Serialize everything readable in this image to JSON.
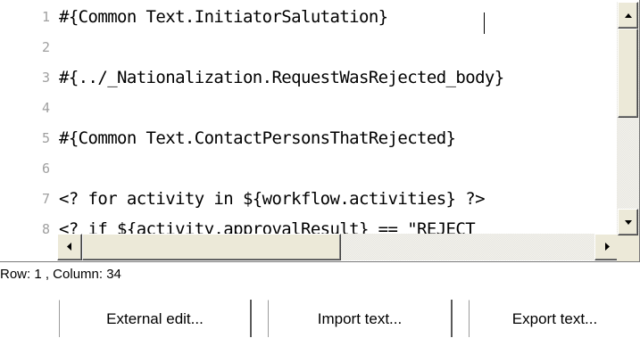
{
  "editor": {
    "lines": [
      {
        "num": "1",
        "text": "#{Common Text.InitiatorSalutation}"
      },
      {
        "num": "2",
        "text": ""
      },
      {
        "num": "3",
        "text": "#{../_Nationalization.RequestWasRejected_body}"
      },
      {
        "num": "4",
        "text": ""
      },
      {
        "num": "5",
        "text": "#{Common Text.ContactPersonsThatRejected}"
      },
      {
        "num": "6",
        "text": ""
      },
      {
        "num": "7",
        "text": "<? for activity in ${workflow.activities} ?>"
      },
      {
        "num": "8",
        "text": "    <? if ${activity.approvalResult} == \"REJECT"
      }
    ]
  },
  "status": {
    "text": "Row: 1 , Column: 34"
  },
  "buttons": {
    "external_edit": "External edit...",
    "import_text": "Import text...",
    "export_text": "Export text..."
  },
  "icons": {
    "scroll_up": "arrow-up-icon",
    "scroll_down": "arrow-down-icon",
    "scroll_left": "arrow-left-icon",
    "scroll_right": "arrow-right-icon"
  }
}
